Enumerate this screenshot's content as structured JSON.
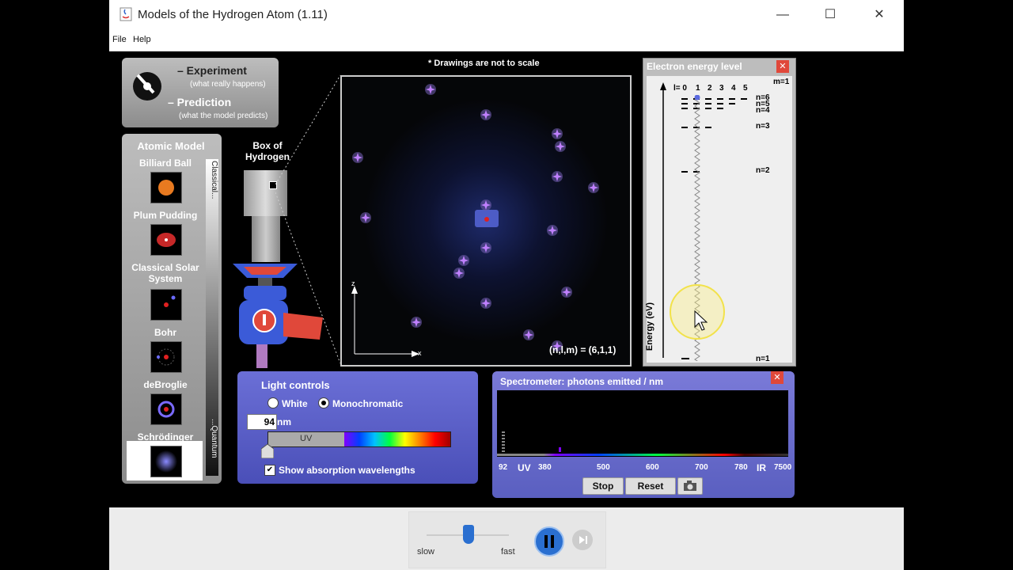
{
  "window": {
    "title": "Models of the Hydrogen Atom (1.11)",
    "minimize": "—",
    "maximize": "☐",
    "close": "✕"
  },
  "menu": {
    "file": "File",
    "help": "Help"
  },
  "mode": {
    "experiment_label": "– Experiment",
    "experiment_sub": "(what really happens)",
    "prediction_label": "– Prediction",
    "prediction_sub": "(what the model predicts)"
  },
  "atomic_model": {
    "title": "Atomic Model",
    "items": [
      "Billiard Ball",
      "Plum Pudding",
      "Classical Solar System",
      "Bohr",
      "deBroglie",
      "Schrödinger"
    ],
    "selected": "Schrödinger",
    "scale_top": "Classical...",
    "scale_bottom": "...Quantum"
  },
  "box": {
    "label": "Box of Hydrogen"
  },
  "view": {
    "note": "* Drawings are not to scale",
    "axis_z": "z",
    "axis_x": "x",
    "state": "(n,l,m) = (6,1,1)"
  },
  "energy": {
    "title": "Electron energy level",
    "m_label": "m=1",
    "l_labels": [
      "l= 0",
      "1",
      "2",
      "3",
      "4",
      "5"
    ],
    "n_labels": [
      "n=6",
      "n=5",
      "n=4",
      "n=3",
      "n=2",
      "n=1"
    ],
    "ylabel": "Energy (eV)",
    "close": "✕"
  },
  "light": {
    "title": "Light controls",
    "white": "White",
    "mono": "Monochromatic",
    "mode_selected": "Monochromatic",
    "wavelength": "94",
    "unit": "nm",
    "uv": "UV",
    "show_absorption": "Show absorption wavelengths",
    "show_absorption_checked": true
  },
  "spectrometer": {
    "title": "Spectrometer: photons emitted / nm",
    "ticks": [
      "92",
      "UV",
      "380",
      "500",
      "600",
      "700",
      "780",
      "IR",
      "7500"
    ],
    "stop": "Stop",
    "reset": "Reset",
    "close": "✕",
    "camera_icon": "camera-icon"
  },
  "clock": {
    "slow": "slow",
    "fast": "fast",
    "speed": 0.6
  },
  "colors": {
    "panel_purple": "#5a5fc8",
    "accent_red": "#e0483a",
    "nucleus": "#e02020"
  }
}
